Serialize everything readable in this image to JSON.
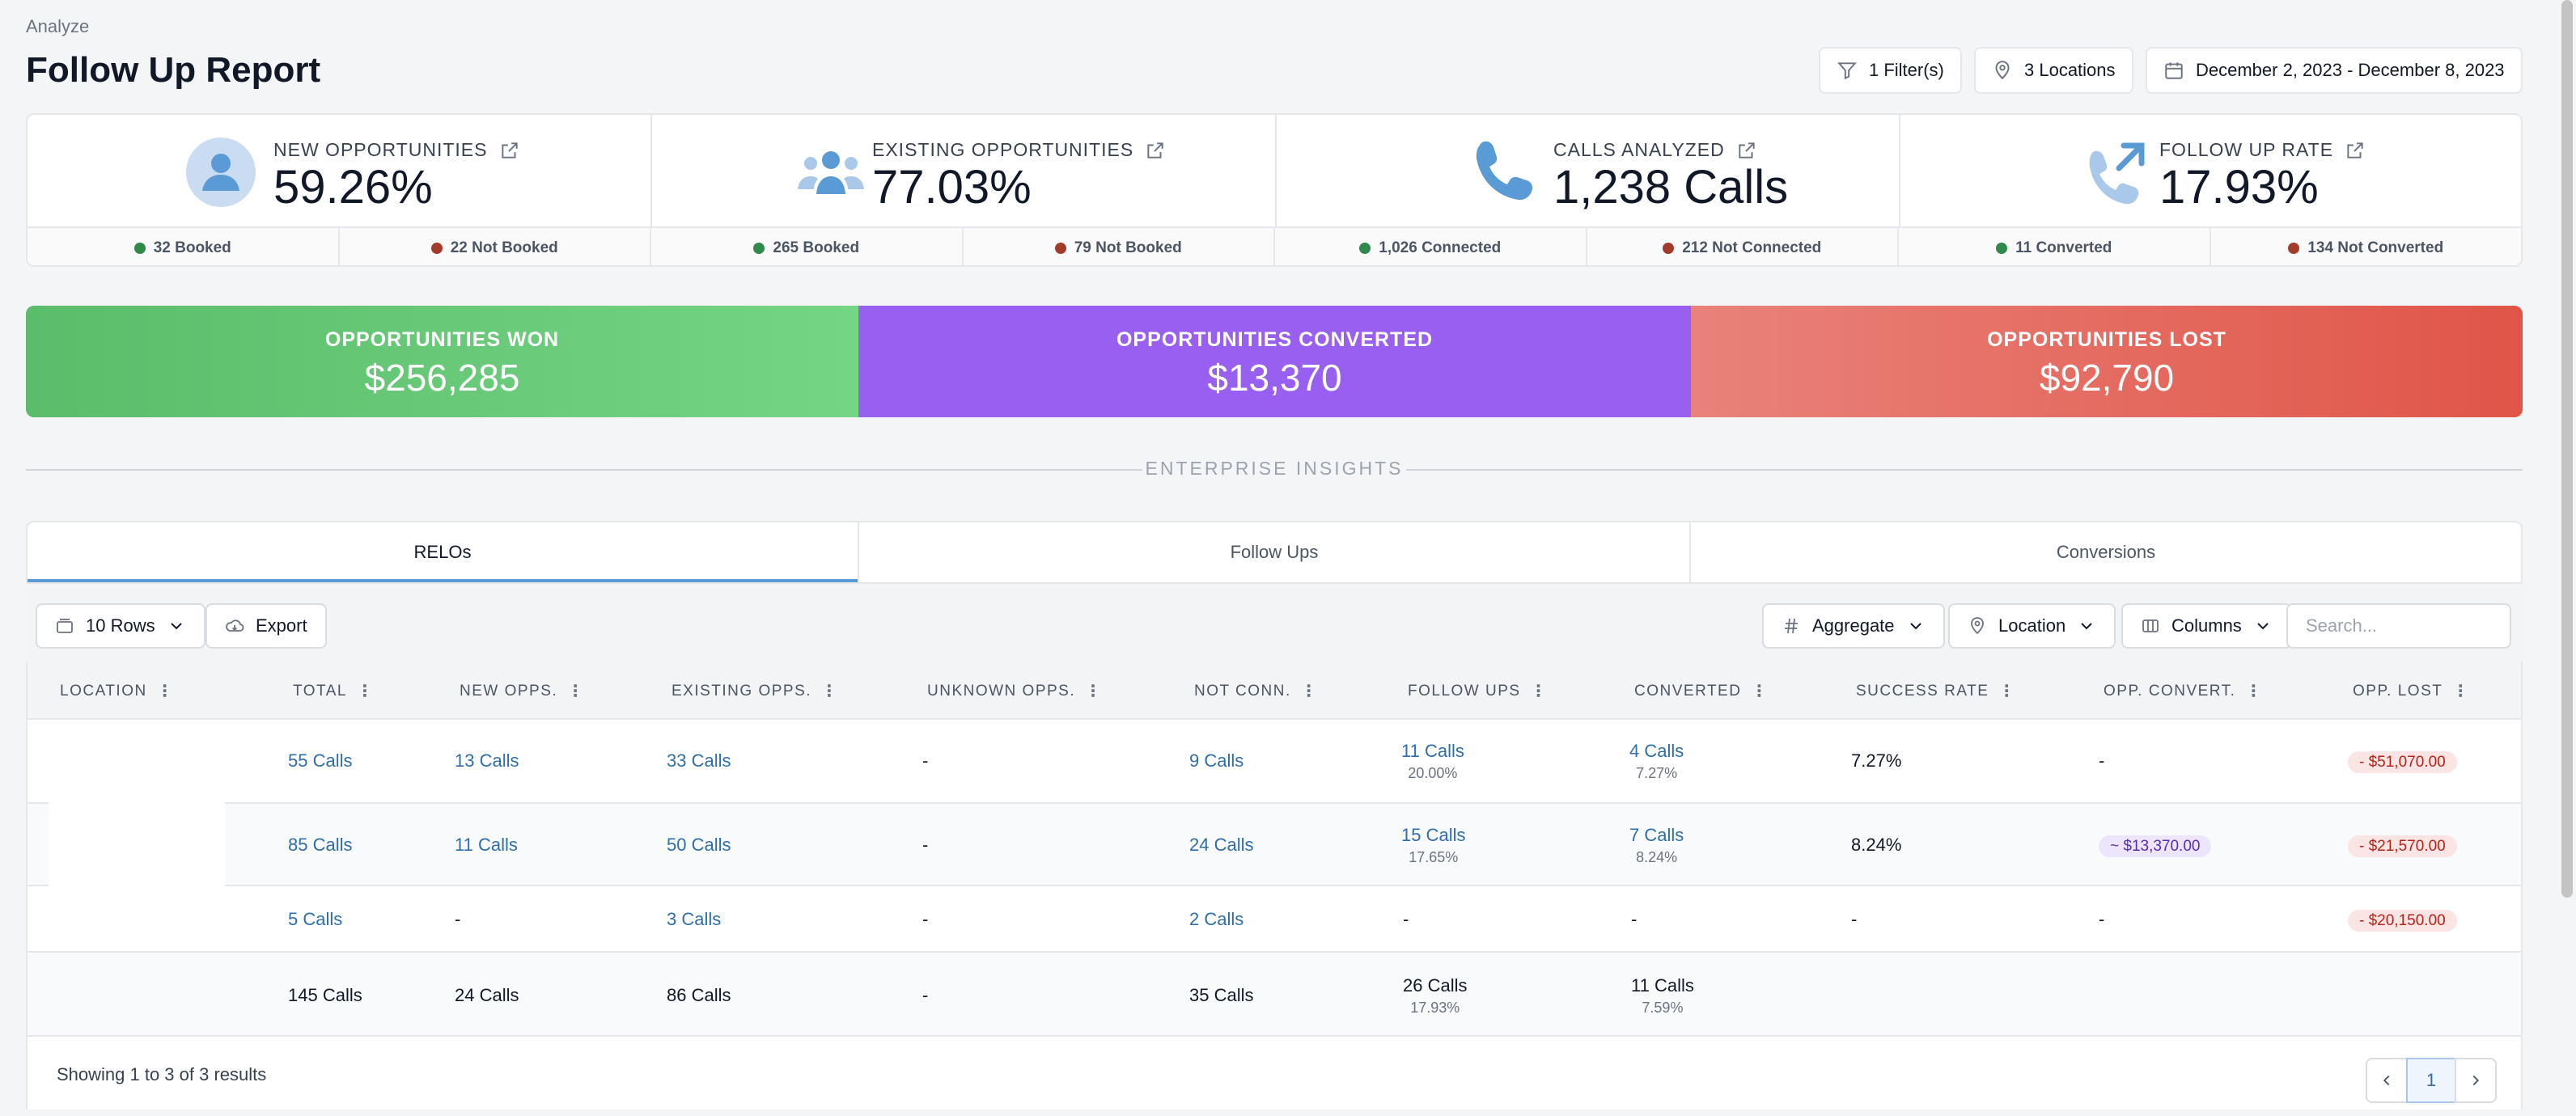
{
  "header": {
    "breadcrumb": "Analyze",
    "title": "Follow Up Report",
    "filters_label": "1 Filter(s)",
    "locations_label": "3 Locations",
    "date_range": "December 2, 2023 - December 8, 2023"
  },
  "kpis": [
    {
      "label": "NEW OPPORTUNITIES",
      "value": "59.26%",
      "icon": "person-icon",
      "sub": [
        {
          "text": "32 Booked",
          "status": "green"
        },
        {
          "text": "22 Not Booked",
          "status": "red"
        }
      ]
    },
    {
      "label": "EXISTING OPPORTUNITIES",
      "value": "77.03%",
      "icon": "group-icon",
      "sub": [
        {
          "text": "265 Booked",
          "status": "green"
        },
        {
          "text": "79 Not Booked",
          "status": "red"
        }
      ]
    },
    {
      "label": "CALLS ANALYZED",
      "value": "1,238 Calls",
      "icon": "phone-icon",
      "sub": [
        {
          "text": "1,026 Connected",
          "status": "green"
        },
        {
          "text": "212 Not Connected",
          "status": "red"
        }
      ]
    },
    {
      "label": "FOLLOW UP RATE",
      "value": "17.93%",
      "icon": "phone-outgoing-icon",
      "sub": [
        {
          "text": "11 Converted",
          "status": "green"
        },
        {
          "text": "134 Not Converted",
          "status": "red"
        }
      ]
    }
  ],
  "tiles": [
    {
      "label": "OPPORTUNITIES WON",
      "value": "$256,285"
    },
    {
      "label": "OPPORTUNITIES CONVERTED",
      "value": "$13,370"
    },
    {
      "label": "OPPORTUNITIES LOST",
      "value": "$92,790"
    }
  ],
  "section_title": "ENTERPRISE INSIGHTS",
  "tabs": [
    {
      "label": "RELOs",
      "active": true
    },
    {
      "label": "Follow Ups",
      "active": false
    },
    {
      "label": "Conversions",
      "active": false
    }
  ],
  "toolbar": {
    "rows_label": "10 Rows",
    "export_label": "Export",
    "aggregate_label": "Aggregate",
    "location_label": "Location",
    "columns_label": "Columns",
    "search_placeholder": "Search..."
  },
  "table": {
    "columns": [
      "LOCATION",
      "TOTAL",
      "NEW OPPS.",
      "EXISTING OPPS.",
      "UNKNOWN OPPS.",
      "NOT CONN.",
      "FOLLOW UPS",
      "CONVERTED",
      "SUCCESS RATE",
      "OPP. CONVERT.",
      "OPP. LOST"
    ],
    "rows": [
      {
        "location": "",
        "total": "55 Calls",
        "new_opps": "13 Calls",
        "existing_opps": "33 Calls",
        "unknown_opps": "-",
        "not_conn": "9 Calls",
        "follow_ups": "11 Calls",
        "follow_ups_pct": "20.00%",
        "converted": "4 Calls",
        "converted_pct": "7.27%",
        "success_rate": "7.27%",
        "opp_convert": "-",
        "opp_lost": "- $51,070.00"
      },
      {
        "location": "",
        "total": "85 Calls",
        "new_opps": "11 Calls",
        "existing_opps": "50 Calls",
        "unknown_opps": "-",
        "not_conn": "24 Calls",
        "follow_ups": "15 Calls",
        "follow_ups_pct": "17.65%",
        "converted": "7 Calls",
        "converted_pct": "8.24%",
        "success_rate": "8.24%",
        "opp_convert": "~ $13,370.00",
        "opp_lost": "- $21,570.00"
      },
      {
        "location": "",
        "total": "5 Calls",
        "new_opps": "-",
        "existing_opps": "3 Calls",
        "unknown_opps": "-",
        "not_conn": "2 Calls",
        "follow_ups": "-",
        "follow_ups_pct": "",
        "converted": "-",
        "converted_pct": "",
        "success_rate": "-",
        "opp_convert": "-",
        "opp_lost": "- $20,150.00"
      }
    ],
    "totals": {
      "total": "145 Calls",
      "new_opps": "24 Calls",
      "existing_opps": "86 Calls",
      "unknown_opps": "-",
      "not_conn": "35 Calls",
      "follow_ups": "26 Calls",
      "follow_ups_pct": "17.93%",
      "converted": "11 Calls",
      "converted_pct": "7.59%"
    },
    "showing": "Showing 1 to 3 of 3 results",
    "current_page": "1"
  },
  "colors": {
    "won": "#5bbd6a",
    "converted": "#985ff0",
    "lost": "#e05548",
    "link": "#2f6ea8",
    "accent": "#5b9bd5"
  }
}
